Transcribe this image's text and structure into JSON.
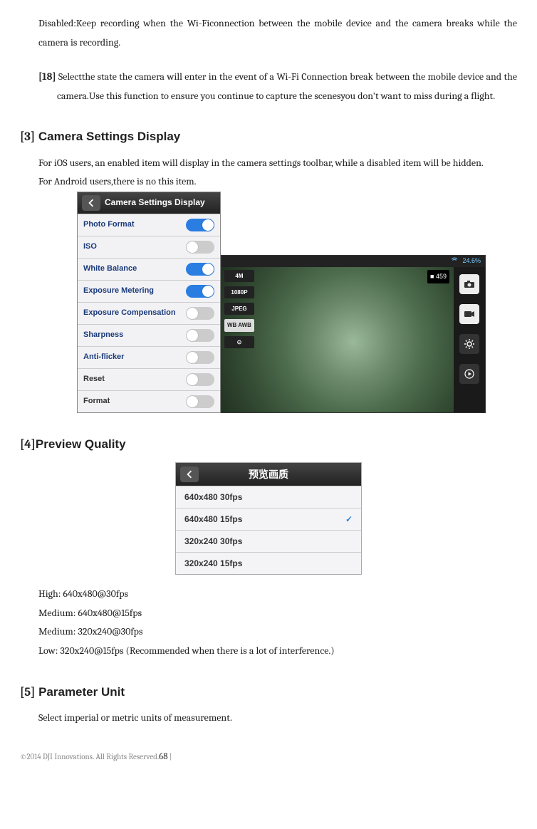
{
  "p1": "Disabled:Keep recording when the Wi-Ficonnection between the mobile device and the camera breaks while the camera is recording.",
  "item18": {
    "num": "[18]",
    "text": " Selectthe state the camera will enter in the event of a Wi-Fi Connection break between the mobile device and the camera.Use this function to ensure you continue to capture the scenesyou don't want to miss during a flight."
  },
  "sec3": {
    "heading_num": "[3]",
    "heading_text": " Camera Settings Display",
    "p1": "For iOS users, an enabled item will display in the camera settings toolbar, while a disabled item will be hidden.",
    "p2": "For Android users,there is no this item."
  },
  "csd": {
    "title": "Camera Settings Display",
    "rows": [
      {
        "label": "Photo Format",
        "on": true
      },
      {
        "label": "ISO",
        "on": false
      },
      {
        "label": "White Balance",
        "on": true
      },
      {
        "label": "Exposure Metering",
        "on": true
      },
      {
        "label": "Exposure Compensation",
        "on": false
      },
      {
        "label": "Sharpness",
        "on": false
      },
      {
        "label": "Anti-flicker",
        "on": false
      },
      {
        "label": "Reset",
        "on": false
      },
      {
        "label": "Format",
        "on": false
      }
    ]
  },
  "cam": {
    "battery": "24.6%",
    "counter": "459",
    "left_pills": [
      "4M",
      "1080P",
      "JPEG",
      "WB AWB",
      "⊙"
    ]
  },
  "sec4": {
    "heading_num": "[4]",
    "heading_text": "Preview Quality"
  },
  "pq": {
    "title": "预览画质",
    "rows": [
      {
        "label": "640x480 30fps",
        "check": false
      },
      {
        "label": "640x480 15fps",
        "check": true
      },
      {
        "label": "320x240 30fps",
        "check": false
      },
      {
        "label": "320x240 15fps",
        "check": false
      }
    ],
    "lines": [
      "High: 640x480@30fps",
      "Medium: 640x480@15fps",
      "Medium: 320x240@30fps",
      "Low: 320x240@15fps (Recommended when there is a lot of interference.)"
    ]
  },
  "sec5": {
    "heading_num": "[5]",
    "heading_text": " Parameter Unit",
    "p1": "Select imperial or metric units of measurement."
  },
  "footer": {
    "text": "©2014 DJI Innovations. All Rights Reserved.",
    "page": "68",
    "bar": " | "
  }
}
